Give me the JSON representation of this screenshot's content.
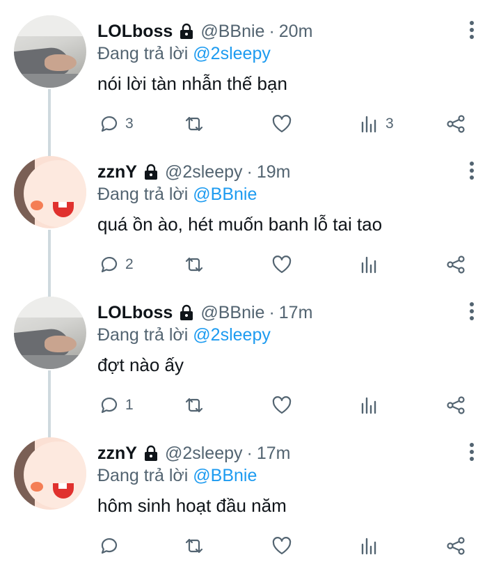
{
  "reply_prefix": "Đang trả lời",
  "tweets": [
    {
      "display_name": "LOLboss",
      "handle": "@BBnie",
      "separator": "·",
      "time": "20m",
      "reply_to": "@2sleepy",
      "text": "nói lời tàn nhẫn thế bạn",
      "reply_count": "3",
      "retweet_count": "",
      "like_count": "",
      "view_count": "3",
      "avatar": "photo"
    },
    {
      "display_name": "zznY",
      "handle": "@2sleepy",
      "separator": "·",
      "time": "19m",
      "reply_to": "@BBnie",
      "text": "quá ồn ào, hét muốn banh lỗ tai tao",
      "reply_count": "2",
      "retweet_count": "",
      "like_count": "",
      "view_count": "",
      "avatar": "toy"
    },
    {
      "display_name": "LOLboss",
      "handle": "@BBnie",
      "separator": "·",
      "time": "17m",
      "reply_to": "@2sleepy",
      "text": "đợt nào ấy",
      "reply_count": "1",
      "retweet_count": "",
      "like_count": "",
      "view_count": "",
      "avatar": "photo"
    },
    {
      "display_name": "zznY",
      "handle": "@2sleepy",
      "separator": "·",
      "time": "17m",
      "reply_to": "@BBnie",
      "text": "hôm sinh hoạt đầu năm",
      "reply_count": "",
      "retweet_count": "",
      "like_count": "",
      "view_count": "",
      "avatar": "toy"
    }
  ],
  "icons": {
    "lock": "lock-icon",
    "more": "more-vertical-icon",
    "reply": "reply-bubble-icon",
    "retweet": "retweet-icon",
    "like": "heart-icon",
    "views": "views-bar-chart-icon",
    "share": "share-icon"
  },
  "colors": {
    "text": "#0f1419",
    "secondary": "#536471",
    "link": "#1d9bf0",
    "thread_line": "#cfd9de"
  }
}
